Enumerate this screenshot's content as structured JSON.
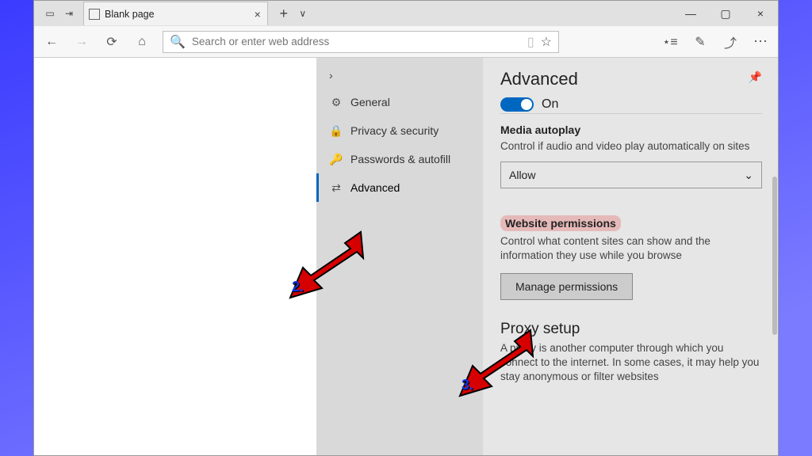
{
  "window": {
    "tab_title": "Blank page"
  },
  "addressbar": {
    "placeholder": "Search or enter web address"
  },
  "icons": {
    "back": "←",
    "forward": "→",
    "refresh": "⟳",
    "home": "⌂",
    "search": "🔍",
    "reading": "▯",
    "star": "☆",
    "fav_list": "⋆≡",
    "pen": "✎",
    "share": "⤴",
    "more": "⋯",
    "new_tab": "+",
    "tab_list": "∨",
    "tab_close": "×",
    "minimize": "—",
    "maximize": "▢",
    "close": "×",
    "tabgroups": "▭",
    "tabaside": "⇥",
    "page": "▭",
    "chevron_right": "›",
    "gear": "⚙",
    "lock": "🔒",
    "key": "🔑",
    "sliders": "⇄",
    "pin": "📌",
    "chevron_down": "⌄"
  },
  "sidebar": {
    "items": [
      {
        "label": "General"
      },
      {
        "label": "Privacy & security"
      },
      {
        "label": "Passwords & autofill"
      },
      {
        "label": "Advanced"
      }
    ]
  },
  "panel": {
    "title": "Advanced",
    "toggle_label": "On",
    "media": {
      "title": "Media autoplay",
      "desc": "Control if audio and video play automatically on sites",
      "select_value": "Allow"
    },
    "perms": {
      "title": "Website permissions",
      "desc": "Control what content sites can show and the information they use while you browse",
      "button": "Manage permissions"
    },
    "proxy": {
      "title": "Proxy setup",
      "desc": "A proxy is another computer through which you connect to the internet. In some cases, it may help you stay anonymous or filter websites"
    }
  },
  "callouts": {
    "a2": "2.",
    "a3": "3."
  }
}
